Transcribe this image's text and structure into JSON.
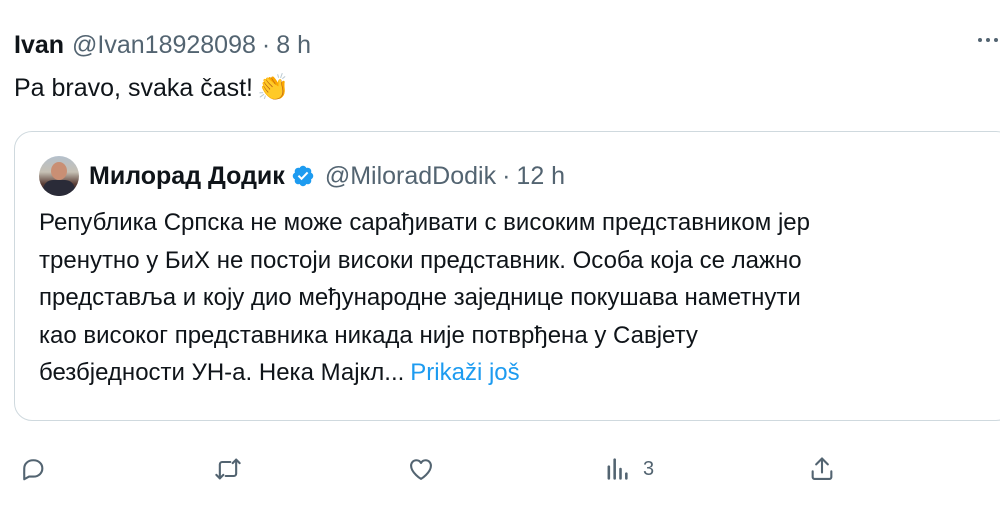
{
  "tweet": {
    "author_name": "Ivan",
    "author_handle": "@Ivan18928098",
    "separator": "·",
    "time": "8 h",
    "text": "Pa bravo, svaka čast!",
    "emoji": "👏"
  },
  "quoted_tweet": {
    "author_name": "Милорад Додик",
    "author_handle": "@MiloradDodik",
    "separator": "·",
    "time": "12 h",
    "verified_color": "#1d9bf0",
    "lines": [
      "Република Српска не може сарађивати с високим представником јер",
      "тренутно у БиХ не постоји високи представник. Особа која се лажно",
      "представља и коју дио међународне заједнице покушава наметнути",
      "као високог представника никада није потврђена у Савјету",
      "безбједности УН-а. Нека Мајкл..."
    ],
    "show_more_label": "Prikaži još"
  },
  "actions": {
    "reply_icon": "reply-icon",
    "retweet_icon": "retweet-icon",
    "like_icon": "like-icon",
    "views_icon": "views-icon",
    "views_count": "3",
    "share_icon": "share-icon"
  },
  "colors": {
    "text": "#0f1419",
    "secondary": "#536471",
    "link": "#1d9bf0",
    "border": "#cfd9de"
  }
}
